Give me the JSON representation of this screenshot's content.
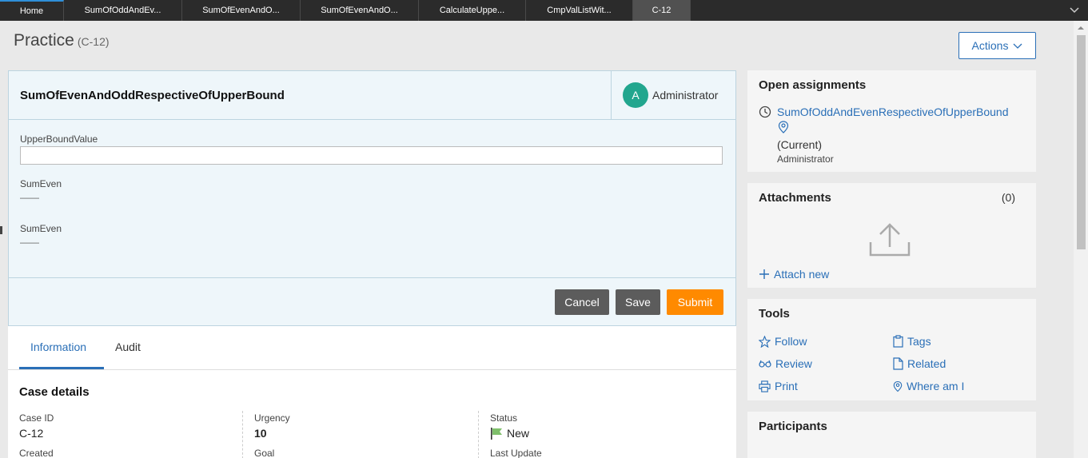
{
  "tabs": [
    {
      "label": "Home"
    },
    {
      "label": "SumOfOddAndEv..."
    },
    {
      "label": "SumOfEvenAndO..."
    },
    {
      "label": "SumOfEvenAndO..."
    },
    {
      "label": "CalculateUppe..."
    },
    {
      "label": "CmpValListWit..."
    },
    {
      "label": "C-12"
    }
  ],
  "page": {
    "title": "Practice",
    "case_id": "(C-12)",
    "actions_label": "Actions"
  },
  "assignment": {
    "title": "SumOfEvenAndOddRespectiveOfUpperBound",
    "user_initial": "A",
    "user_name": "Administrator",
    "fields": [
      {
        "label": "UpperBoundValue",
        "value": ""
      },
      {
        "label": "SumEven",
        "value": "——"
      },
      {
        "label": "SumEven",
        "value": "——"
      }
    ],
    "buttons": {
      "cancel": "Cancel",
      "save": "Save",
      "submit": "Submit"
    }
  },
  "info": {
    "tabs": {
      "information": "Information",
      "audit": "Audit"
    },
    "section_title": "Case details",
    "case_id_label": "Case ID",
    "case_id_value": "C-12",
    "urgency_label": "Urgency",
    "urgency_value": "10",
    "status_label": "Status",
    "status_value": "New",
    "created_label": "Created",
    "goal_label": "Goal",
    "last_update_label": "Last Update"
  },
  "open_assignments": {
    "title": "Open assignments",
    "link": "SumOfOddAndEvenRespectiveOfUpperBound",
    "current": "(Current)",
    "user": "Administrator"
  },
  "attachments": {
    "title": "Attachments",
    "count": "(0)",
    "attach_new": "Attach new"
  },
  "tools": {
    "title": "Tools",
    "items": [
      {
        "label": "Follow",
        "icon": "star-icon"
      },
      {
        "label": "Tags",
        "icon": "clipboard-icon"
      },
      {
        "label": "Review",
        "icon": "glasses-icon"
      },
      {
        "label": "Related",
        "icon": "document-icon"
      },
      {
        "label": "Print",
        "icon": "printer-icon"
      },
      {
        "label": "Where am I",
        "icon": "location-pin-icon"
      }
    ]
  },
  "participants": {
    "title": "Participants"
  },
  "colors": {
    "accent": "#2a6fb7",
    "submit": "#ff8a00",
    "avatar": "#22a68e",
    "status_flag": "#7fbf6b"
  }
}
